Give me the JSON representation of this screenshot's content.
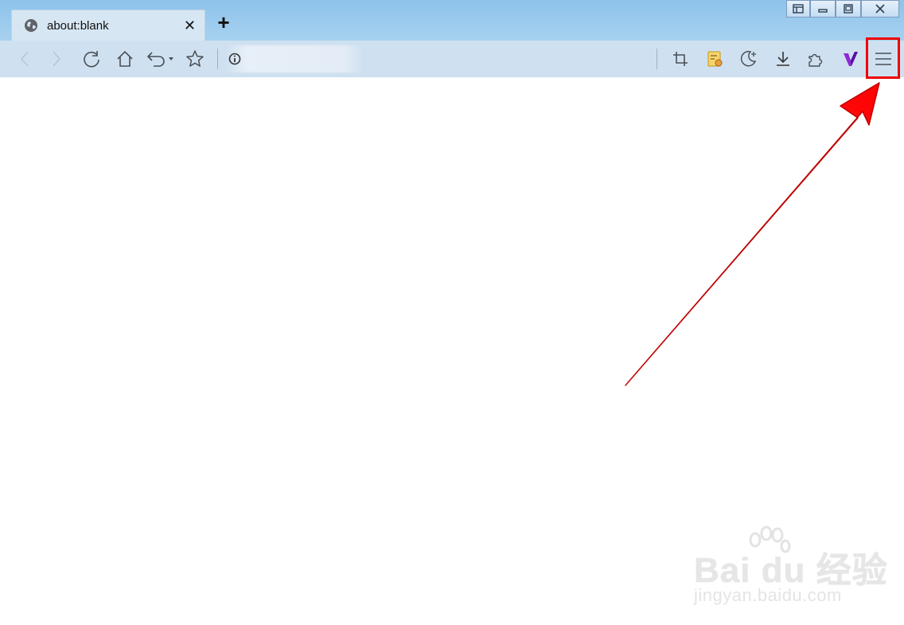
{
  "window": {
    "controls": [
      "layout-icon",
      "minimize-icon",
      "maximize-icon",
      "close-icon"
    ]
  },
  "tab": {
    "title": "about:blank",
    "close_glyph": "✕",
    "new_tab_glyph": "+"
  },
  "toolbar": {
    "left_buttons": [
      "back-icon",
      "forward-icon",
      "refresh-icon",
      "home-icon",
      "undo-icon",
      "favorite-star-icon"
    ],
    "right_buttons": [
      "screenshot-crop-icon",
      "notes-icon",
      "night-mode-icon",
      "download-icon",
      "extensions-icon",
      "v-logo-icon",
      "menu-icon"
    ]
  },
  "colors": {
    "highlight": "#e00000",
    "arrow": "#ff0000",
    "frame": "#a5d0ef",
    "toolbar": "#cfe1f0"
  },
  "watermark": {
    "brand": "Bai du 经验",
    "url": "jingyan.baidu.com"
  }
}
